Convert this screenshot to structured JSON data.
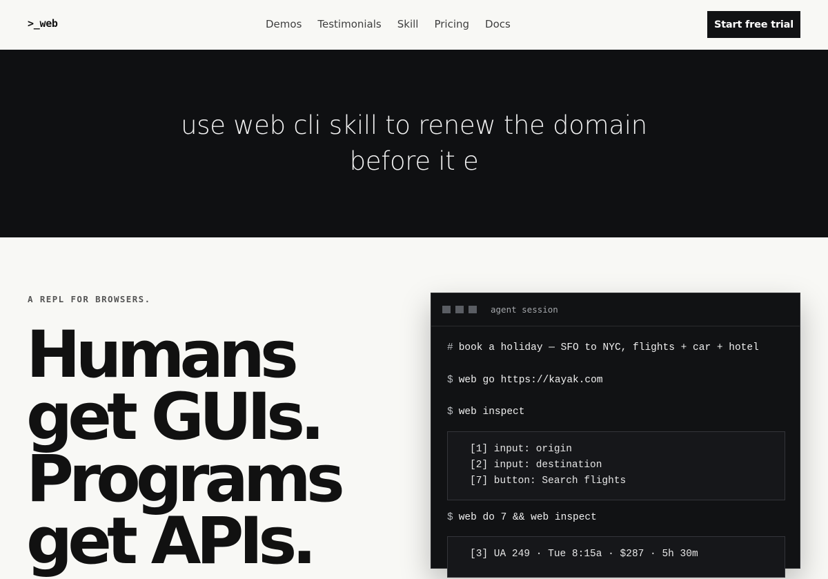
{
  "nav": {
    "logo": ">_web",
    "links": [
      "Demos",
      "Testimonials",
      "Skill",
      "Pricing",
      "Docs"
    ],
    "cta": "Start free trial"
  },
  "banner": {
    "line1": "use web cli skill to renew the domain",
    "line2": "before it e"
  },
  "hero": {
    "eyebrow": "A REPL FOR BROWSERS.",
    "headline": [
      "Humans",
      "get GUIs.",
      "Programs",
      "get APIs."
    ]
  },
  "terminal": {
    "title": "agent session",
    "comment_prompt": "#",
    "comment": "book a holiday — SFO to NYC, flights + car + hotel",
    "prompt": "$",
    "cmd1": "web go https://kayak.com",
    "cmd2": "web inspect",
    "output1": [
      "[1] input: origin",
      "[2] input: destination",
      "[7] button: Search flights"
    ],
    "cmd3": "web do 7 && web inspect",
    "output2": [
      "[3] UA 249 · Tue 8:15a · $287 · 5h 30m"
    ]
  },
  "colors": {
    "page_bg": "#f8f8f5",
    "banner_bg": "#0f1012",
    "terminal_bg": "#111214",
    "cta_bg": "#111214"
  }
}
